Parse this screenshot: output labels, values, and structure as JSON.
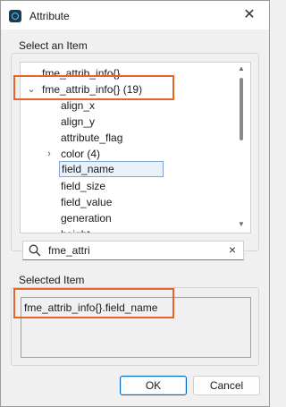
{
  "window": {
    "title": "Attribute"
  },
  "select_group": {
    "label": "Select an Item"
  },
  "tree": {
    "items": [
      {
        "label": "fme_attrib_info{}",
        "expandable": false
      },
      {
        "label": "fme_attrib_info{} (19)",
        "expandable": true,
        "expanded": true
      },
      {
        "label": "align_x"
      },
      {
        "label": "align_y"
      },
      {
        "label": "attribute_flag"
      },
      {
        "label": "color (4)",
        "expandable": true,
        "expanded": false
      },
      {
        "label": "field_name",
        "selected": true
      },
      {
        "label": "field_size"
      },
      {
        "label": "field_value"
      },
      {
        "label": "generation"
      },
      {
        "label": "height"
      }
    ]
  },
  "search": {
    "value": "fme_attri"
  },
  "selected_group": {
    "label": "Selected Item",
    "value": "fme_attrib_info{}.field_name"
  },
  "buttons": {
    "ok": "OK",
    "cancel": "Cancel"
  },
  "colors": {
    "highlight": "#e8622a",
    "selection_border": "#7ea6d6",
    "primary_border": "#0067c0"
  }
}
